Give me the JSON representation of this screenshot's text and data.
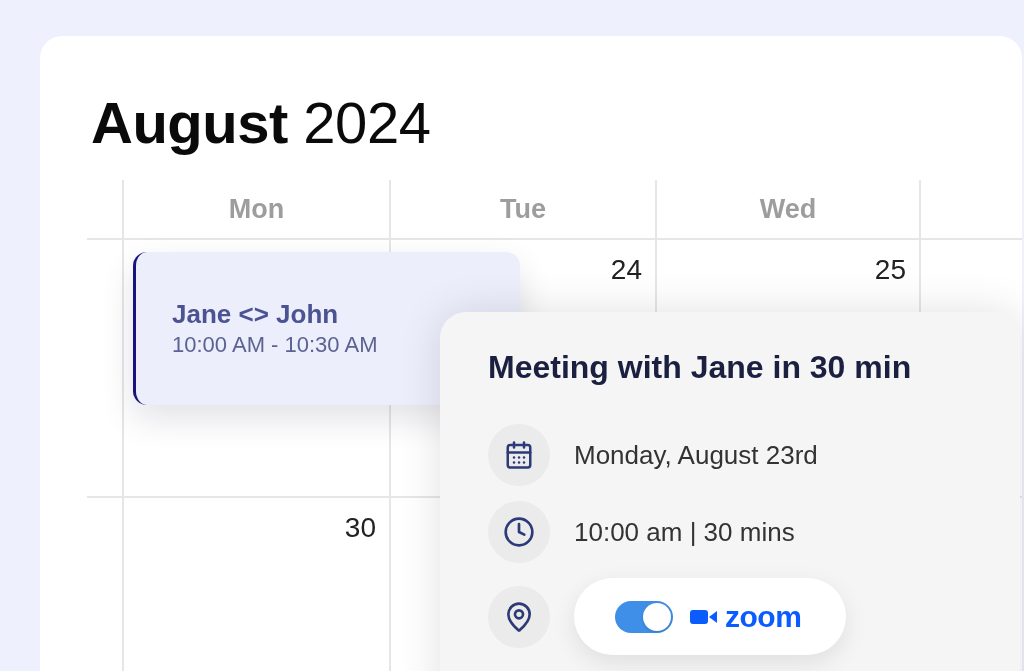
{
  "calendar": {
    "title": "**August** 2024",
    "weekdays": [
      "Mon",
      "Tue",
      "Wed"
    ],
    "weeks": [
      {
        "days": [
          {
            "events": [
              {
                "title": "Jane <> John",
                "time": "10:00 AM - 10:30 AM"
              }
            ]
          },
          {
            "date": "24"
          },
          {
            "date": "25"
          }
        ]
      },
      {
        "days": [
          {
            "date": "30"
          }
        ]
      }
    ]
  },
  "popup": {
    "title": "Meeting with Jane in 30 min",
    "details": [
      {
        "kind": "date",
        "text": "Monday, August 23rd"
      },
      {
        "kind": "time",
        "text": "10:00 am | 30 mins"
      },
      {
        "kind": "location",
        "toggle": {
          "on": true
        },
        "app": "zoom"
      }
    ]
  }
}
